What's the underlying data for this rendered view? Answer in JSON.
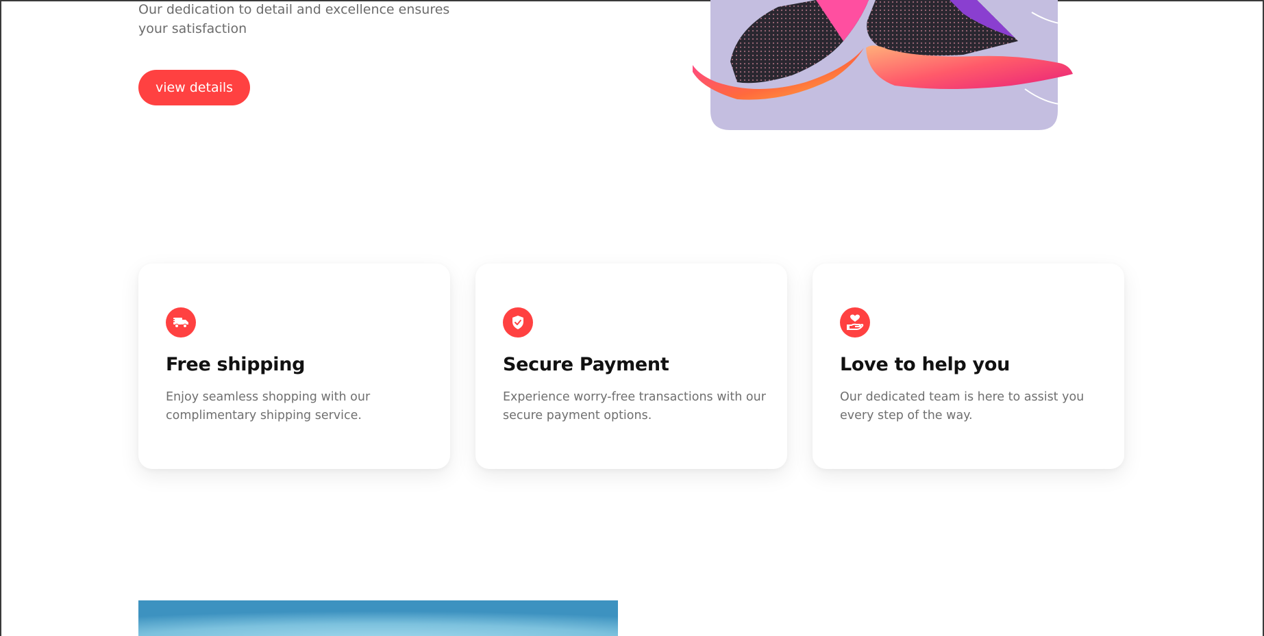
{
  "hero": {
    "description": "Our dedication to detail and excellence ensures your satisfaction",
    "button_label": "view details"
  },
  "features": [
    {
      "icon": "shipping-truck-icon",
      "title": "Free shipping",
      "description": "Enjoy seamless shopping with our complimentary shipping service."
    },
    {
      "icon": "shield-check-icon",
      "title": "Secure Payment",
      "description": "Experience worry-free transactions with our secure payment options."
    },
    {
      "icon": "heart-hand-icon",
      "title": "Love to help you",
      "description": "Our dedicated team is here to assist you every step of the way."
    }
  ],
  "colors": {
    "accent": "#ff4141",
    "hero_image_bg": "#c4bee0",
    "sky_blue": "#5aa9cf"
  }
}
